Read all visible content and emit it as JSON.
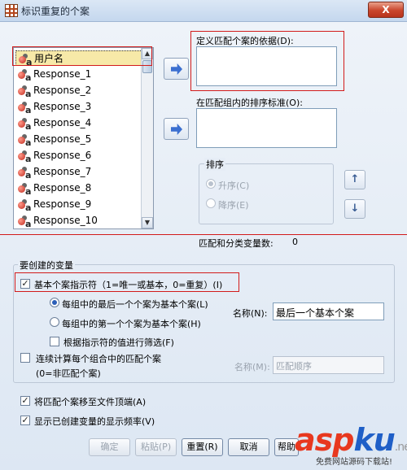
{
  "window": {
    "title": "标识重复的个案",
    "close_glyph": "X"
  },
  "variables": {
    "items": [
      {
        "label": "用户名",
        "selected": true
      },
      {
        "label": "Response_1"
      },
      {
        "label": "Response_2"
      },
      {
        "label": "Response_3"
      },
      {
        "label": "Response_4"
      },
      {
        "label": "Response_5"
      },
      {
        "label": "Response_6"
      },
      {
        "label": "Response_7"
      },
      {
        "label": "Response_8"
      },
      {
        "label": "Response_9"
      },
      {
        "label": "Response_10"
      }
    ],
    "icon": "nominal-string-variable-icon"
  },
  "match_basis": {
    "label": "定义匹配个案的依据(D):"
  },
  "sort_within": {
    "label": "在匹配组内的排序标准(O):"
  },
  "sort_order": {
    "title": "排序",
    "ascending": "升序(C)",
    "descending": "降序(E)"
  },
  "match_count": {
    "label": "匹配和分类变量数:",
    "value": "0"
  },
  "create_vars": {
    "title": "要创建的变量",
    "primary_indicator": "基本个案指示符（1=唯一或基本，0=重复）(I)",
    "last_case": "每组中的最后一个个案为基本个案(L)",
    "first_case": "每组中的第一个个案为基本个案(H)",
    "filter_by": "根据指示符的值进行筛选(F)",
    "name_label": "名称(N):",
    "name_value": "最后一个基本个案",
    "sequential": "连续计算每个组合中的匹配个案",
    "sequential_note": "(0=非匹配个案)",
    "name2_label": "名称(M):",
    "name2_value": "匹配顺序"
  },
  "options": {
    "move_top": "将匹配个案移至文件顶端(A)",
    "show_freq": "显示已创建变量的显示频率(V)"
  },
  "buttons": {
    "ok": "确定",
    "paste": "粘贴(P)",
    "reset": "重置(R)",
    "cancel": "取消",
    "help": "帮助"
  },
  "watermark": {
    "asp": "asp",
    "ku": "ku",
    "tld": ".net",
    "sub": "免费网站源码下载站!"
  },
  "colors": {
    "annotation_red": "#d21b1b",
    "selection": "#f7e9a8"
  }
}
